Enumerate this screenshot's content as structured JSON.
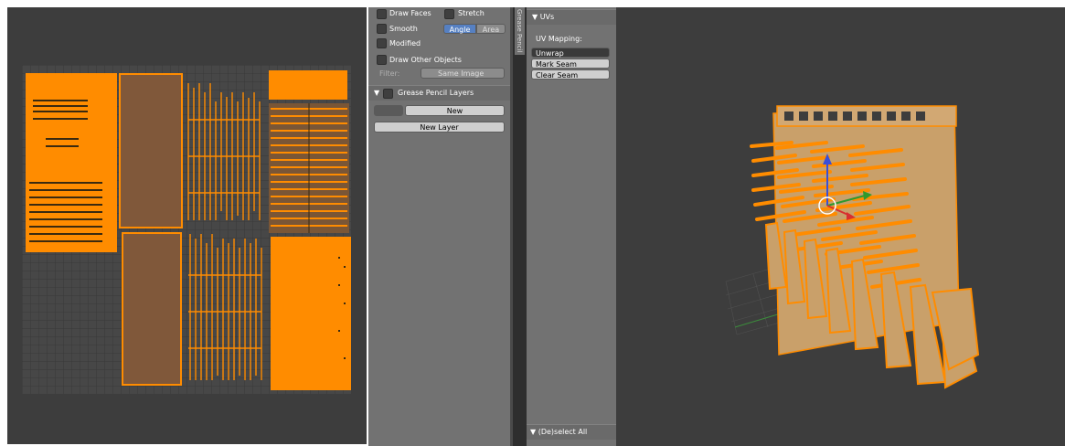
{
  "uv_editor": {
    "image_description_icon": "uv-layout-icon"
  },
  "properties": {
    "draw_faces_label": "Draw Faces",
    "stretch_label": "Stretch",
    "smooth_label": "Smooth",
    "angle_label": "Angle",
    "area_label": "Area",
    "modified_label": "Modified",
    "draw_other_objects_label": "Draw Other Objects",
    "filter_label": "Filter:",
    "filter_value": "Same Image",
    "grease_pencil_title": "Grease Pencil Layers",
    "new_label": "New",
    "new_layer_label": "New Layer"
  },
  "side_tab": {
    "label": "Grease Pencil"
  },
  "tool_panel": {
    "uvs_title": "UVs",
    "uv_mapping_label": "UV Mapping:",
    "unwrap_label": "Unwrap",
    "mark_seam_label": "Mark Seam",
    "clear_seam_label": "Clear Seam",
    "deselect_all_label": "(De)select All"
  },
  "colors": {
    "selection_orange": "#ff8c00",
    "panel_gray": "#727272",
    "editor_bg": "#3d3d3d",
    "active_blue": "#5680c2"
  }
}
